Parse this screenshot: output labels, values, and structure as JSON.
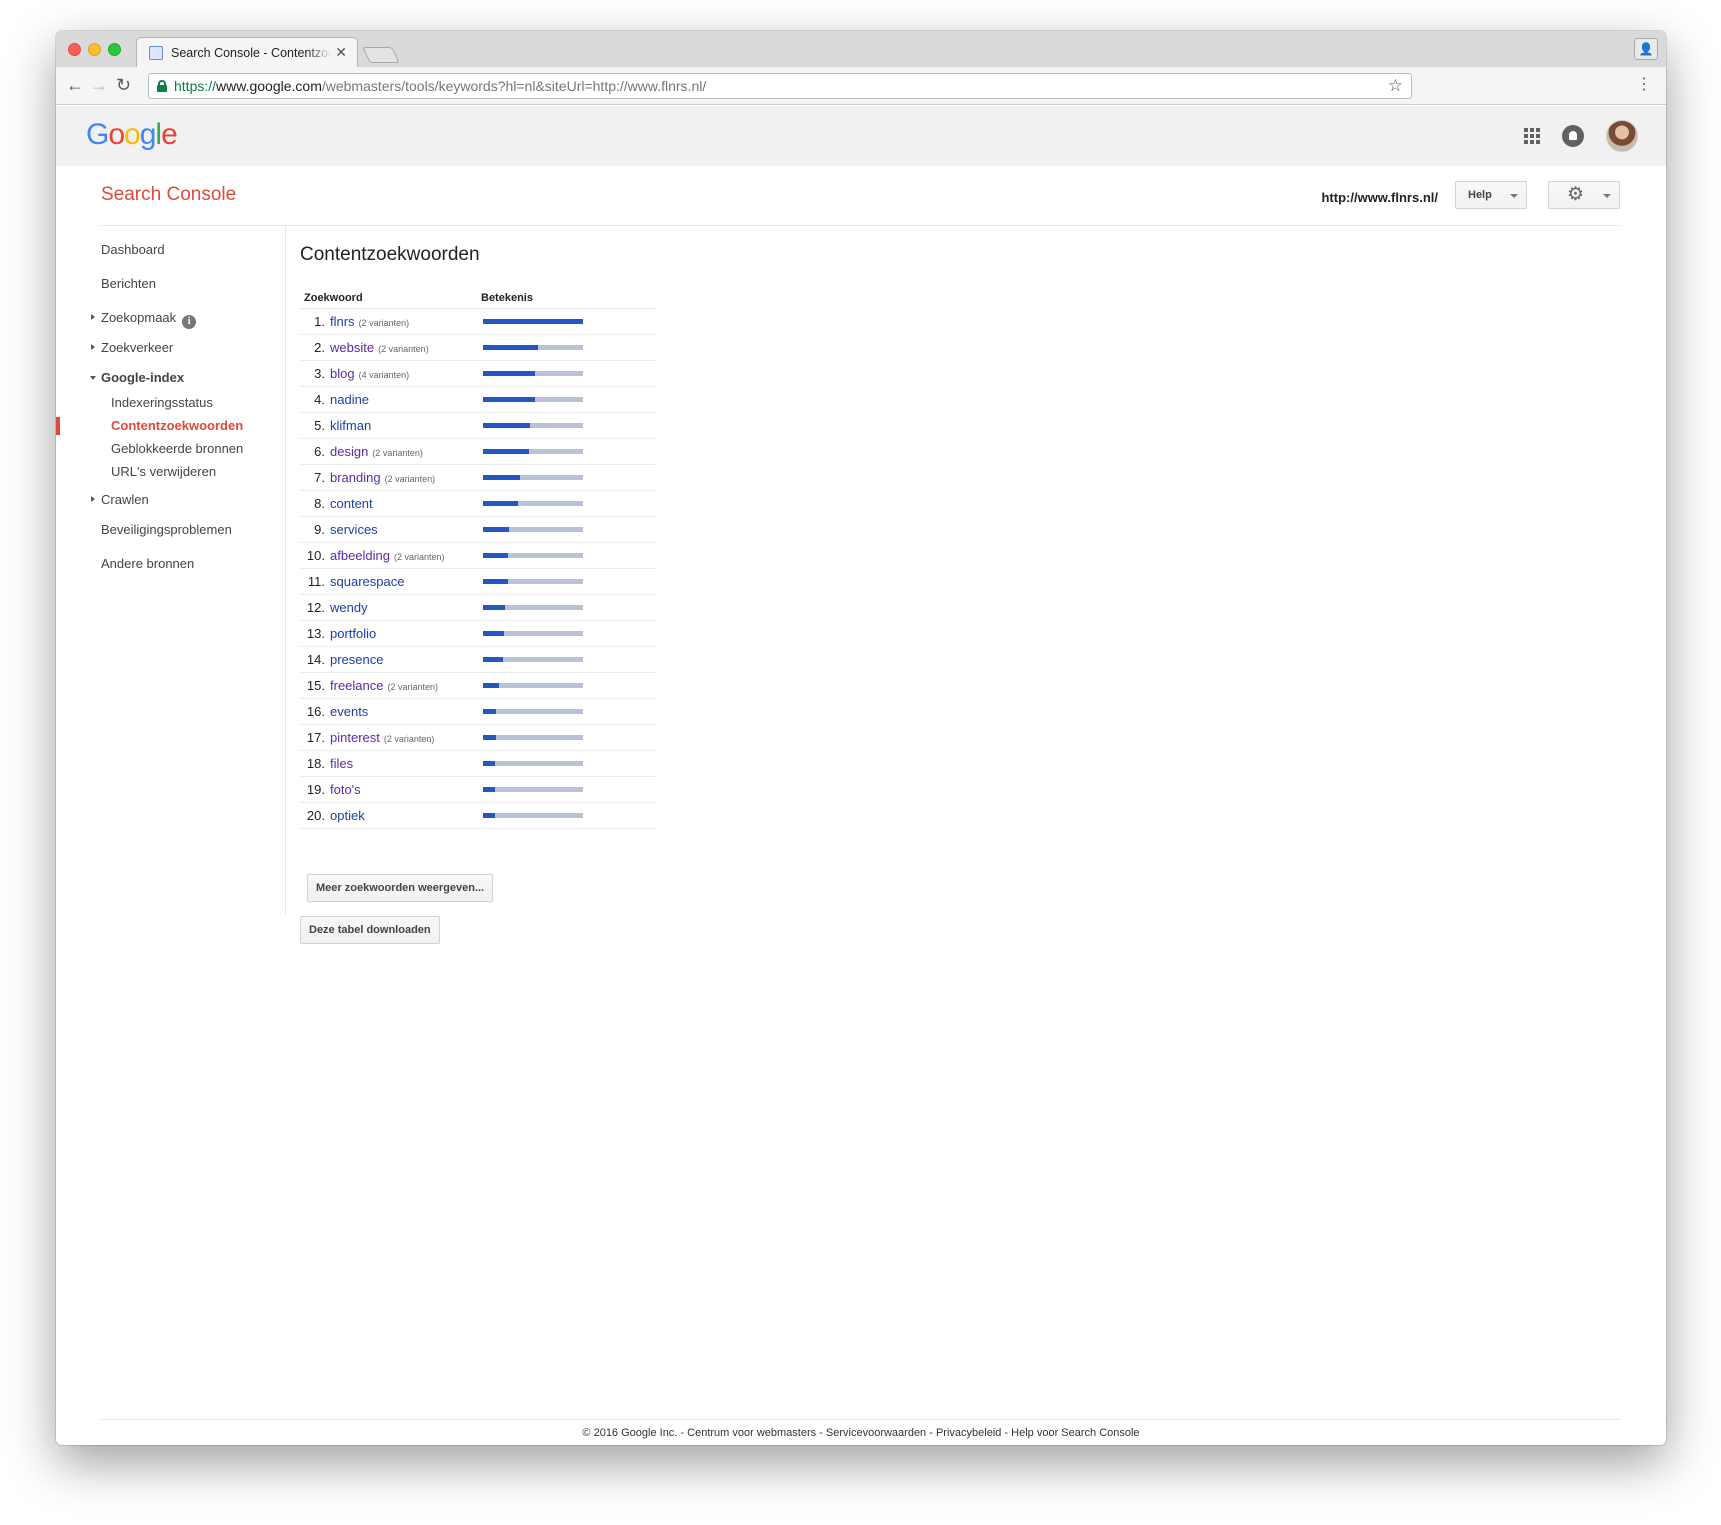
{
  "browser": {
    "tab_title": "Search Console - Contentzoekwoorden",
    "url_scheme": "https://",
    "url_host": "www.google.com",
    "url_path": "/webmasters/tools/keywords?hl=nl&siteUrl=http://www.flnrs.nl/"
  },
  "gbar": {
    "logo_letters": [
      "G",
      "o",
      "o",
      "g",
      "l",
      "e"
    ],
    "logo_colors": [
      "#4285f4",
      "#ea4335",
      "#fbbc05",
      "#4285f4",
      "#34a853",
      "#ea4335"
    ]
  },
  "header": {
    "title": "Search Console",
    "site_url": "http://www.flnrs.nl/",
    "help_label": "Help"
  },
  "sidebar": {
    "items": [
      {
        "label": "Dashboard"
      },
      {
        "label": "Berichten"
      },
      {
        "label": "Zoekopmaak"
      },
      {
        "label": "Zoekverkeer"
      },
      {
        "label": "Google-index"
      },
      {
        "label": "Crawlen"
      },
      {
        "label": "Beveiligingsproblemen"
      },
      {
        "label": "Andere bronnen"
      }
    ],
    "subitems": [
      {
        "label": "Indexeringsstatus"
      },
      {
        "label": "Contentzoekwoorden"
      },
      {
        "label": "Geblokkeerde bronnen"
      },
      {
        "label": "URL's verwijderen"
      }
    ]
  },
  "main": {
    "title": "Contentzoekwoorden",
    "col_keyword": "Zoekwoord",
    "col_significance": "Betekenis",
    "more_button": "Meer zoekwoorden weergeven...",
    "download_button": "Deze tabel downloaden",
    "keywords": [
      {
        "num": "1.",
        "word": "flnrs",
        "variants": "(2 varianten)",
        "value": 1.0
      },
      {
        "num": "2.",
        "word": "website",
        "variants": "(2 varianten)",
        "value": 0.55
      },
      {
        "num": "3.",
        "word": "blog",
        "variants": "(4 varianten)",
        "value": 0.52
      },
      {
        "num": "4.",
        "word": "nadine",
        "variants": "",
        "value": 0.52
      },
      {
        "num": "5.",
        "word": "klifman",
        "variants": "",
        "value": 0.47
      },
      {
        "num": "6.",
        "word": "design",
        "variants": "(2 varianten)",
        "value": 0.46
      },
      {
        "num": "7.",
        "word": "branding",
        "variants": "(2 varianten)",
        "value": 0.37
      },
      {
        "num": "8.",
        "word": "content",
        "variants": "",
        "value": 0.35
      },
      {
        "num": "9.",
        "word": "services",
        "variants": "",
        "value": 0.26
      },
      {
        "num": "10.",
        "word": "afbeelding",
        "variants": "(2 varianten)",
        "value": 0.25
      },
      {
        "num": "11.",
        "word": "squarespace",
        "variants": "",
        "value": 0.25
      },
      {
        "num": "12.",
        "word": "wendy",
        "variants": "",
        "value": 0.22
      },
      {
        "num": "13.",
        "word": "portfolio",
        "variants": "",
        "value": 0.21
      },
      {
        "num": "14.",
        "word": "presence",
        "variants": "",
        "value": 0.2
      },
      {
        "num": "15.",
        "word": "freelance",
        "variants": "(2 varianten)",
        "value": 0.16
      },
      {
        "num": "16.",
        "word": "events",
        "variants": "",
        "value": 0.13
      },
      {
        "num": "17.",
        "word": "pinterest",
        "variants": "(2 varianten)",
        "value": 0.13
      },
      {
        "num": "18.",
        "word": "files",
        "variants": "",
        "value": 0.12
      },
      {
        "num": "19.",
        "word": "foto's",
        "variants": "",
        "value": 0.12
      },
      {
        "num": "20.",
        "word": "optiek",
        "variants": "",
        "value": 0.12
      }
    ]
  },
  "footer": {
    "text": "© 2016 Google Inc. - Centrum voor webmasters - Servicevoorwaarden - Privacybeleid - Help voor Search Console"
  }
}
